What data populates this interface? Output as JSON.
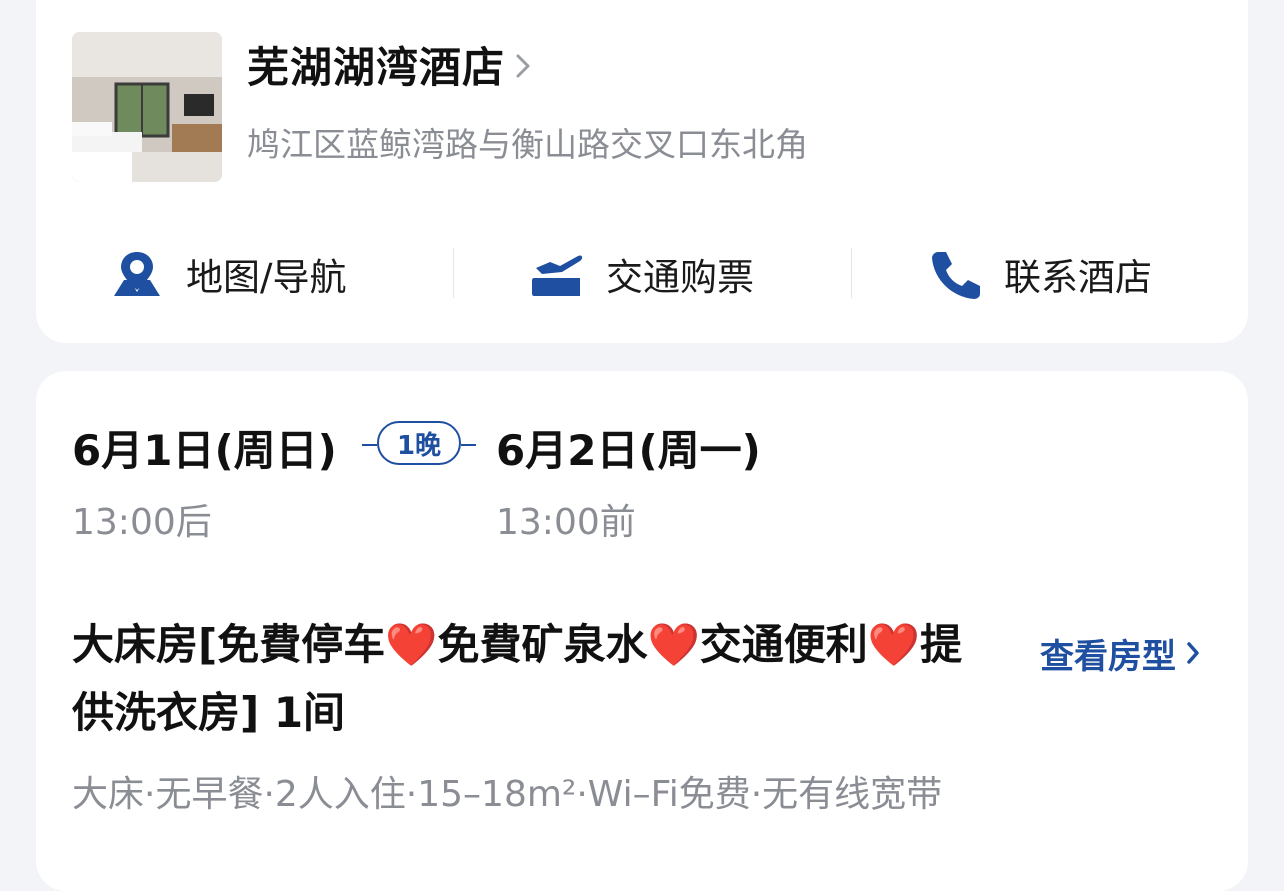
{
  "hotel": {
    "name": "芜湖湖湾酒店",
    "address": "鸠江区蓝鲸湾路与衡山路交叉口东北角"
  },
  "actions": {
    "map": {
      "label": "地图/导航",
      "icon": "map-pin-icon"
    },
    "transport": {
      "label": "交通购票",
      "icon": "plane-ticket-icon"
    },
    "call": {
      "label": "联系酒店",
      "icon": "phone-icon"
    }
  },
  "booking": {
    "checkin_date": "6月1日(周日)",
    "checkin_time": "13:00后",
    "nights": "1晚",
    "checkout_date": "6月2日(周一)",
    "checkout_time": "13:00前"
  },
  "room": {
    "title": "大床房[免費停车❤️免費矿泉水❤️交通便利❤️提供洗衣房] 1间",
    "view_label": "查看房型",
    "features": "大床·无早餐·2人入住·15–18m²·Wi–Fi免费·无有线宽带"
  },
  "colors": {
    "accent": "#1f4fa0",
    "text_primary": "#111111",
    "text_secondary": "#8a8d94",
    "page_bg": "#f2f4f8",
    "card_bg": "#ffffff"
  }
}
